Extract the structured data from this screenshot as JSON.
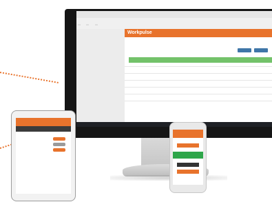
{
  "colors": {
    "accent_orange": "#e8732c",
    "green": "#73c26a",
    "blue_button": "#3f76a8",
    "dark_bezel": "#151515"
  },
  "monitor": {
    "app_title": "Workpulse",
    "tabs": [
      "",
      "",
      ""
    ],
    "sidebar_items": [
      "",
      "",
      "",
      "",
      "",
      "",
      "",
      ""
    ],
    "header_buttons": [
      "",
      ""
    ]
  },
  "tablet": {
    "screen_title": "",
    "list_labels": [
      "",
      "",
      ""
    ]
  },
  "phone": {
    "title": ""
  }
}
